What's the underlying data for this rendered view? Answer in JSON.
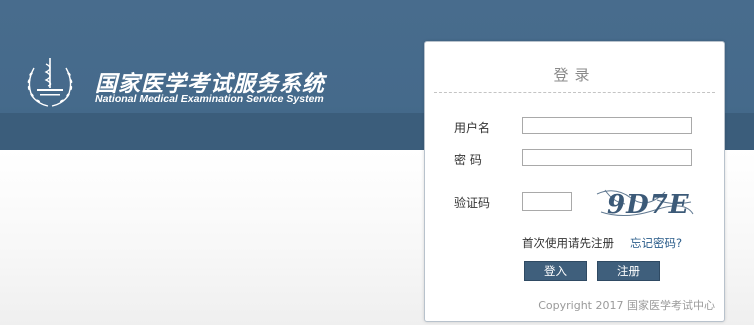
{
  "header": {
    "title": "国家医学考试服务系统",
    "subtitle": "National Medical Examination Service System",
    "logo_icon": "caduceus-wreath-logo-icon"
  },
  "login": {
    "title": "登录",
    "username_label": "用户名",
    "username_value": "",
    "password_label": "密 码",
    "password_value": "",
    "captcha_label": "验证码",
    "captcha_value": "",
    "captcha_text": "9D7E",
    "first_time_text": "首次使用请先注册",
    "forgot_link": "忘记密码?",
    "login_button": "登入",
    "register_button": "注册",
    "copyright": "Copyright 2017 国家医学考试中心"
  },
  "colors": {
    "header_bg": "#486c8d",
    "header_band": "#3b5d7b",
    "button_bg": "#3f5f7c",
    "link": "#2a5c8a"
  }
}
